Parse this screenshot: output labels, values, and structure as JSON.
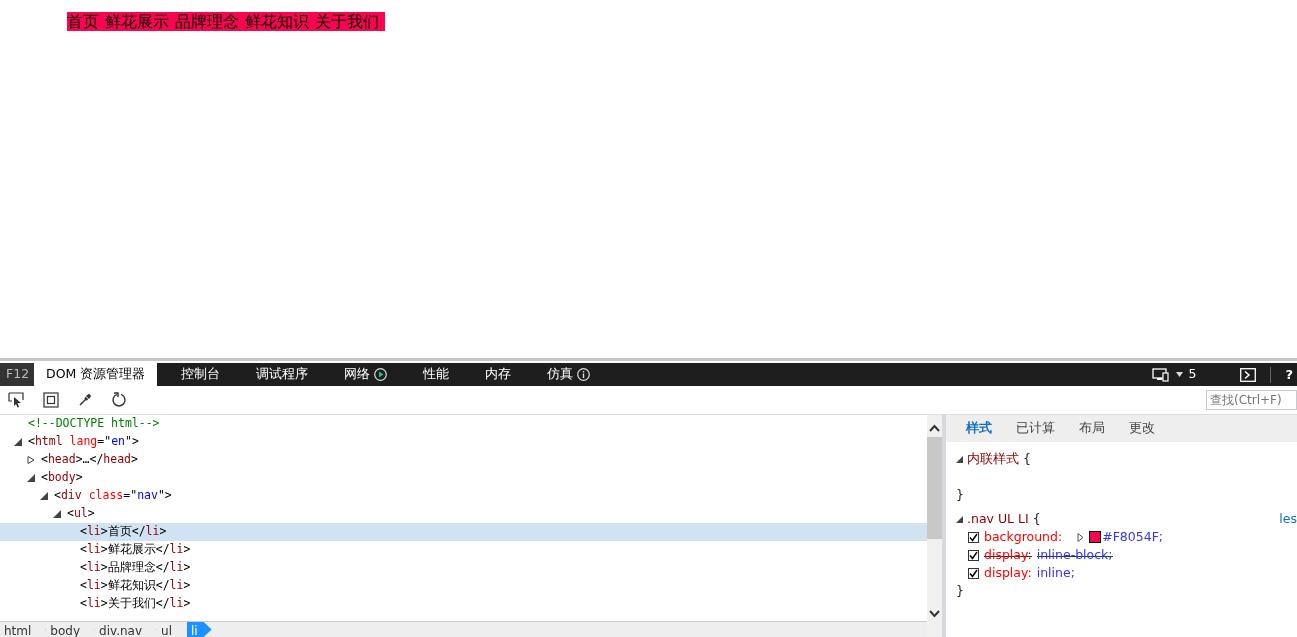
{
  "page": {
    "nav_items": [
      "首页",
      "鲜花展示",
      "品牌理念",
      "鲜花知识",
      "关于我们"
    ]
  },
  "devtools": {
    "f12_label": "F12",
    "tabs": [
      {
        "label": "DOM 资源管理器",
        "selected": true,
        "kind": "plain"
      },
      {
        "label": "控制台",
        "selected": false,
        "kind": "plain"
      },
      {
        "label": "调试程序",
        "selected": false,
        "kind": "plain"
      },
      {
        "label": "网络",
        "selected": false,
        "kind": "play"
      },
      {
        "label": "性能",
        "selected": false,
        "kind": "plain"
      },
      {
        "label": "内存",
        "selected": false,
        "kind": "plain"
      },
      {
        "label": "仿真",
        "selected": false,
        "kind": "info"
      }
    ],
    "target_count": "5",
    "help_label": "?",
    "search": {
      "placeholder": "查找(Ctrl+F)"
    },
    "dom_tree": [
      {
        "selected": false,
        "tokens": [
          {
            "kind": "comment",
            "text": "<!--DOCTYPE html-->"
          }
        ]
      },
      {
        "selected": false,
        "expanded": true,
        "tokens": [
          {
            "kind": "punct",
            "text": "<"
          },
          {
            "kind": "tag",
            "text": "html"
          },
          {
            "kind": "attr",
            "text": " lang"
          },
          {
            "kind": "punct",
            "text": "=\""
          },
          {
            "kind": "value",
            "text": "en"
          },
          {
            "kind": "punct",
            "text": "\">"
          }
        ],
        "children": [
          {
            "selected": false,
            "expanded": false,
            "tokens": [
              {
                "kind": "punct",
                "text": "<"
              },
              {
                "kind": "tag",
                "text": "head"
              },
              {
                "kind": "punct",
                "text": ">…</"
              },
              {
                "kind": "tag",
                "text": "head"
              },
              {
                "kind": "punct",
                "text": ">"
              }
            ]
          },
          {
            "selected": false,
            "expanded": true,
            "tokens": [
              {
                "kind": "punct",
                "text": "<"
              },
              {
                "kind": "tag",
                "text": "body"
              },
              {
                "kind": "punct",
                "text": ">"
              }
            ],
            "children": [
              {
                "selected": false,
                "expanded": true,
                "tokens": [
                  {
                    "kind": "punct",
                    "text": "<"
                  },
                  {
                    "kind": "tag",
                    "text": "div"
                  },
                  {
                    "kind": "attr",
                    "text": " class"
                  },
                  {
                    "kind": "punct",
                    "text": "=\""
                  },
                  {
                    "kind": "value",
                    "text": "nav"
                  },
                  {
                    "kind": "punct",
                    "text": "\">"
                  }
                ],
                "children": [
                  {
                    "selected": false,
                    "expanded": true,
                    "tokens": [
                      {
                        "kind": "punct",
                        "text": "<"
                      },
                      {
                        "kind": "tag",
                        "text": "ul"
                      },
                      {
                        "kind": "punct",
                        "text": ">"
                      }
                    ],
                    "children": [
                      {
                        "selected": true,
                        "tokens": [
                          {
                            "kind": "punct",
                            "text": "<"
                          },
                          {
                            "kind": "tag",
                            "text": "li"
                          },
                          {
                            "kind": "punct",
                            "text": ">"
                          },
                          {
                            "kind": "text",
                            "text": "首页"
                          },
                          {
                            "kind": "punct",
                            "text": "</"
                          },
                          {
                            "kind": "tag",
                            "text": "li"
                          },
                          {
                            "kind": "punct",
                            "text": ">"
                          }
                        ]
                      },
                      {
                        "selected": false,
                        "tokens": [
                          {
                            "kind": "punct",
                            "text": "<"
                          },
                          {
                            "kind": "tag",
                            "text": "li"
                          },
                          {
                            "kind": "punct",
                            "text": ">"
                          },
                          {
                            "kind": "text",
                            "text": "鲜花展示"
                          },
                          {
                            "kind": "punct",
                            "text": "</"
                          },
                          {
                            "kind": "tag",
                            "text": "li"
                          },
                          {
                            "kind": "punct",
                            "text": ">"
                          }
                        ]
                      },
                      {
                        "selected": false,
                        "tokens": [
                          {
                            "kind": "punct",
                            "text": "<"
                          },
                          {
                            "kind": "tag",
                            "text": "li"
                          },
                          {
                            "kind": "punct",
                            "text": ">"
                          },
                          {
                            "kind": "text",
                            "text": "品牌理念"
                          },
                          {
                            "kind": "punct",
                            "text": "</"
                          },
                          {
                            "kind": "tag",
                            "text": "li"
                          },
                          {
                            "kind": "punct",
                            "text": ">"
                          }
                        ]
                      },
                      {
                        "selected": false,
                        "tokens": [
                          {
                            "kind": "punct",
                            "text": "<"
                          },
                          {
                            "kind": "tag",
                            "text": "li"
                          },
                          {
                            "kind": "punct",
                            "text": ">"
                          },
                          {
                            "kind": "text",
                            "text": "鲜花知识"
                          },
                          {
                            "kind": "punct",
                            "text": "</"
                          },
                          {
                            "kind": "tag",
                            "text": "li"
                          },
                          {
                            "kind": "punct",
                            "text": ">"
                          }
                        ]
                      },
                      {
                        "selected": false,
                        "tokens": [
                          {
                            "kind": "punct",
                            "text": "<"
                          },
                          {
                            "kind": "tag",
                            "text": "li"
                          },
                          {
                            "kind": "punct",
                            "text": ">"
                          },
                          {
                            "kind": "text",
                            "text": "关于我们"
                          },
                          {
                            "kind": "punct",
                            "text": "</"
                          },
                          {
                            "kind": "tag",
                            "text": "li"
                          },
                          {
                            "kind": "punct",
                            "text": ">"
                          }
                        ]
                      }
                    ]
                  }
                ]
              }
            ]
          }
        ]
      }
    ],
    "breadcrumbs": [
      {
        "label": "html",
        "selected": false
      },
      {
        "label": "body",
        "selected": false
      },
      {
        "label": "div.nav",
        "selected": false
      },
      {
        "label": "ul",
        "selected": false
      },
      {
        "label": "li",
        "selected": true
      }
    ],
    "style_tabs": [
      {
        "label": "样式",
        "selected": true
      },
      {
        "label": "已计算",
        "selected": false
      },
      {
        "label": "布局",
        "selected": false
      },
      {
        "label": "更改",
        "selected": false
      }
    ],
    "rules": [
      {
        "selector": "内联样式",
        "kind": "inline",
        "open": "{",
        "close": "}"
      },
      {
        "selector": ".nav UL LI",
        "kind": "rule",
        "open": "{",
        "close": "}",
        "source": "les",
        "properties": [
          {
            "name": "background:",
            "value": "#F8054F;",
            "checked": true,
            "overridden": false,
            "kind": "color"
          },
          {
            "name": "display:",
            "value": "inline-block;",
            "checked": true,
            "overridden": true,
            "kind": "plain"
          },
          {
            "name": "display:",
            "value": "inline;",
            "checked": true,
            "overridden": false,
            "kind": "plain"
          }
        ]
      }
    ]
  }
}
